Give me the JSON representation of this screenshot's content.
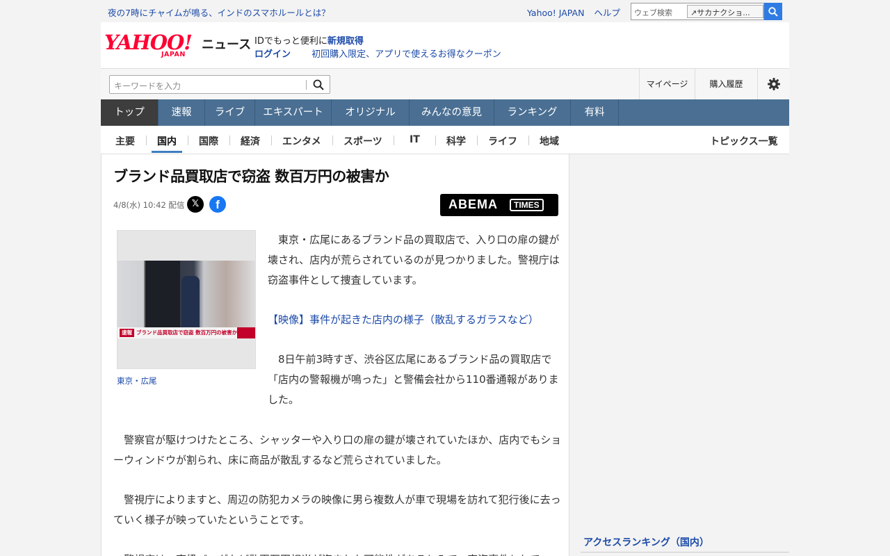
{
  "topbar": {
    "notice": "夜の7時にチャイムが鳴る、インドのスマホルールとは？",
    "yahoo_japan_link": "Yahoo! JAPAN",
    "help_link": "ヘルプ",
    "web_search_placeholder": "ウェブ検索",
    "search_suggestion": "サカナクショ..."
  },
  "header": {
    "logo_text": "YAHOO!",
    "logo_sub": "JAPAN",
    "section_label": "ニュース",
    "id_prefix": "IDでもっと便利に",
    "id_register": "新規取得",
    "login": "ログイン",
    "coupon": "初回購入限定、アプリで使えるお得なクーポン"
  },
  "searchrow": {
    "keyword_placeholder": "キーワードを入力",
    "mypage": "マイページ",
    "history": "購入履歴"
  },
  "mainnav": {
    "items": [
      {
        "label": "トップ",
        "active": true
      },
      {
        "label": "速報"
      },
      {
        "label": "ライブ"
      },
      {
        "label": "エキスパート"
      },
      {
        "label": "オリジナル"
      },
      {
        "label": "みんなの意見"
      },
      {
        "label": "ランキング"
      },
      {
        "label": "有料"
      }
    ]
  },
  "subnav": {
    "items": [
      "主要",
      "国内",
      "国際",
      "経済",
      "エンタメ",
      "スポーツ",
      "IT",
      "科学",
      "ライフ",
      "地域"
    ],
    "active": "国内",
    "topics": "トピックス一覧"
  },
  "article": {
    "headline": "ブランド品買取店で窃盗 数百万円の被害か",
    "date": "4/8(水) 10:42 配信",
    "x_icon": "x-share-icon",
    "facebook_icon": "facebook-share-icon",
    "provider_main": "ABEMA",
    "provider_sub": "TIMES",
    "photo_overlay": "ブランド品買取店で窃盗 数百万円の被害か",
    "photo_tag": "速報",
    "photo_caption": "東京・広尾",
    "lead": "　東京・広尾にあるブランド品の買取店で、入り口の扉の鍵が壊され、店内が荒らされているのが見つかりました。警視庁は窃盗事件として捜査しています。",
    "video_link": "【映像】事件が起きた店内の様子（散乱するガラスなど）",
    "para2": "　8日午前3時すぎ、渋谷区広尾にあるブランド品の買取店で「店内の警報機が鳴った」と警備会社から110番通報がありました。",
    "para3": "　警察官が駆けつけたところ、シャッターや入り口の扉の鍵が壊されていたほか、店内でもショーウィンドウが割られ、床に商品が散乱するなど荒らされていました。",
    "para4": "　警視庁によりますと、周辺の防犯カメラの映像に男ら複数人が車で現場を訪れて犯行後に去っていく様子が映っていたということです。",
    "para5": "　警視庁は、高級バッグなど数百万円相当が盗まれた可能性があるとみて、窃盗事件として"
  },
  "sidebar": {
    "ranking_title": "アクセスランキング（国内）"
  },
  "colors": {
    "nav_bg": "#4a6f93",
    "nav_active": "#3d3d3d",
    "link": "#1b4aa8",
    "brand_red": "#ff0033",
    "search_button": "#2e7be4"
  }
}
